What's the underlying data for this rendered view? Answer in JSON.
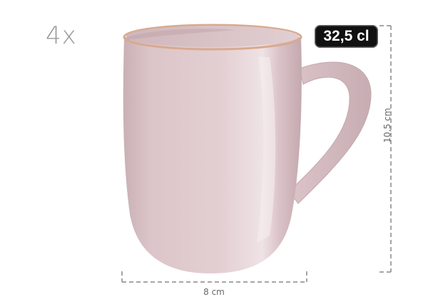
{
  "product": {
    "quantity_label": "4x",
    "volume_badge": "32,5 cl",
    "width_label": "8 cm",
    "height_label": "10,5 cm"
  },
  "colors": {
    "mug_glaze": "#dcc4c8",
    "mug_rim": "#d9a98f",
    "badge_bg": "#111111",
    "dimension_lines": "#888888"
  }
}
